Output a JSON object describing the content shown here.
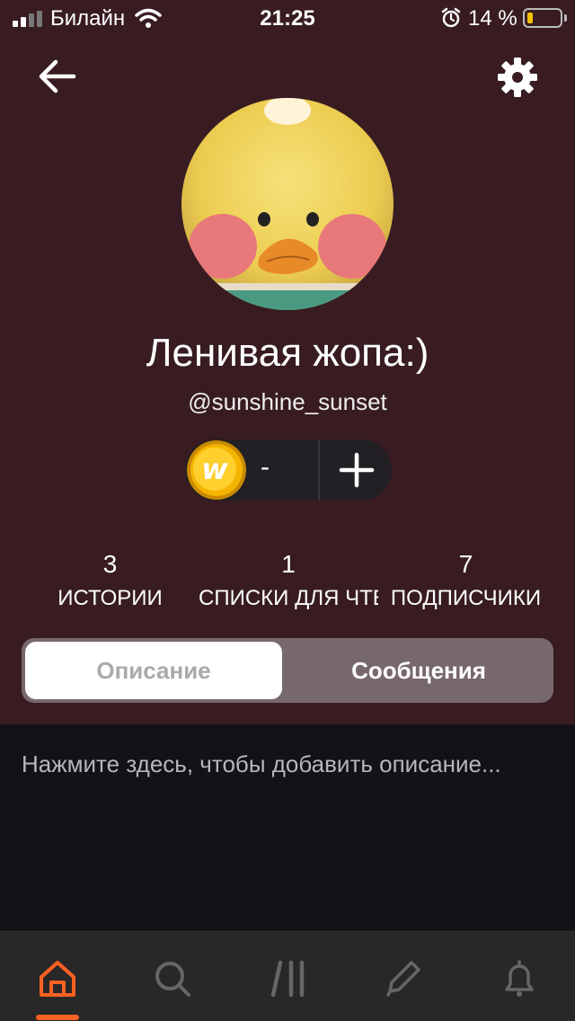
{
  "status_bar": {
    "carrier": "Билайн",
    "time": "21:25",
    "battery": "14 %"
  },
  "profile": {
    "name": "Ленивая жопа:)",
    "handle": "@sunshine_sunset",
    "coins": "-"
  },
  "stats": [
    {
      "value": "3",
      "label": "ИСТОРИИ"
    },
    {
      "value": "1",
      "label": "СПИСКИ ДЛЯ ЧТЕНИЯ"
    },
    {
      "value": "7",
      "label": "ПОДПИСЧИКИ"
    }
  ],
  "tabs": {
    "description": "Описание",
    "messages": "Сообщения"
  },
  "description_prompt": "Нажмите здесь, чтобы добавить описание...",
  "colors": {
    "header_bg": "#381c21",
    "accent": "#ff6122",
    "coin": "#f4b400"
  },
  "icons": [
    "signal-icon",
    "wifi-icon",
    "alarm-icon",
    "battery-icon",
    "back-arrow-icon",
    "gear-icon",
    "coin-icon",
    "plus-icon",
    "home-icon",
    "search-icon",
    "library-icon",
    "pencil-icon",
    "bell-icon"
  ]
}
